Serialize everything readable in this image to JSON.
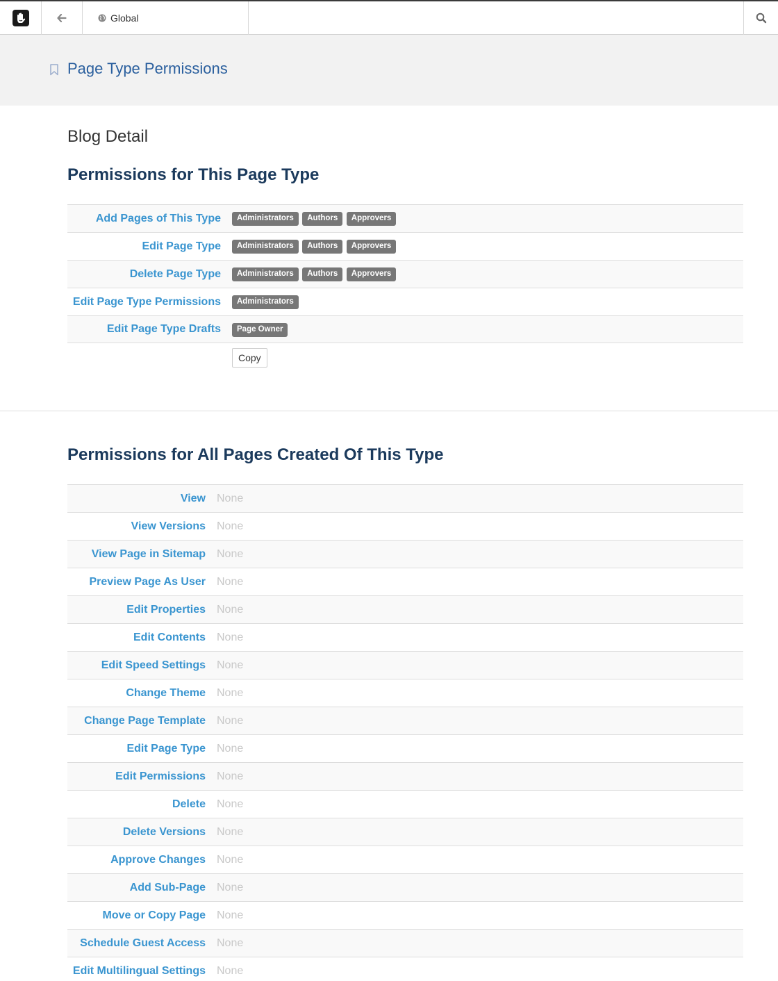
{
  "toolbar": {
    "logo_icon": "concrete5-hand-logo-icon",
    "back_icon": "arrow-left-icon",
    "globe_icon": "globe-icon",
    "global_label": "Global",
    "search_icon": "search-icon"
  },
  "header": {
    "bookmark_icon": "bookmark-icon",
    "title": "Page Type Permissions"
  },
  "page_type_name": "Blog Detail",
  "section1": {
    "title": "Permissions for This Page Type",
    "rows": [
      {
        "label": "Add Pages of This Type",
        "groups": [
          "Administrators",
          "Authors",
          "Approvers"
        ]
      },
      {
        "label": "Edit Page Type",
        "groups": [
          "Administrators",
          "Authors",
          "Approvers"
        ]
      },
      {
        "label": "Delete Page Type",
        "groups": [
          "Administrators",
          "Authors",
          "Approvers"
        ]
      },
      {
        "label": "Edit Page Type Permissions",
        "groups": [
          "Administrators"
        ]
      },
      {
        "label": "Edit Page Type Drafts",
        "groups": [
          "Page Owner"
        ]
      }
    ],
    "copy_label": "Copy"
  },
  "section2": {
    "title": "Permissions for All Pages Created Of This Type",
    "none_text": "None",
    "rows": [
      "View",
      "View Versions",
      "View Page in Sitemap",
      "Preview Page As User",
      "Edit Properties",
      "Edit Contents",
      "Edit Speed Settings",
      "Change Theme",
      "Change Page Template",
      "Edit Page Type",
      "Edit Permissions",
      "Delete",
      "Delete Versions",
      "Approve Changes",
      "Add Sub-Page",
      "Move or Copy Page",
      "Schedule Guest Access",
      "Edit Multilingual Settings"
    ]
  }
}
